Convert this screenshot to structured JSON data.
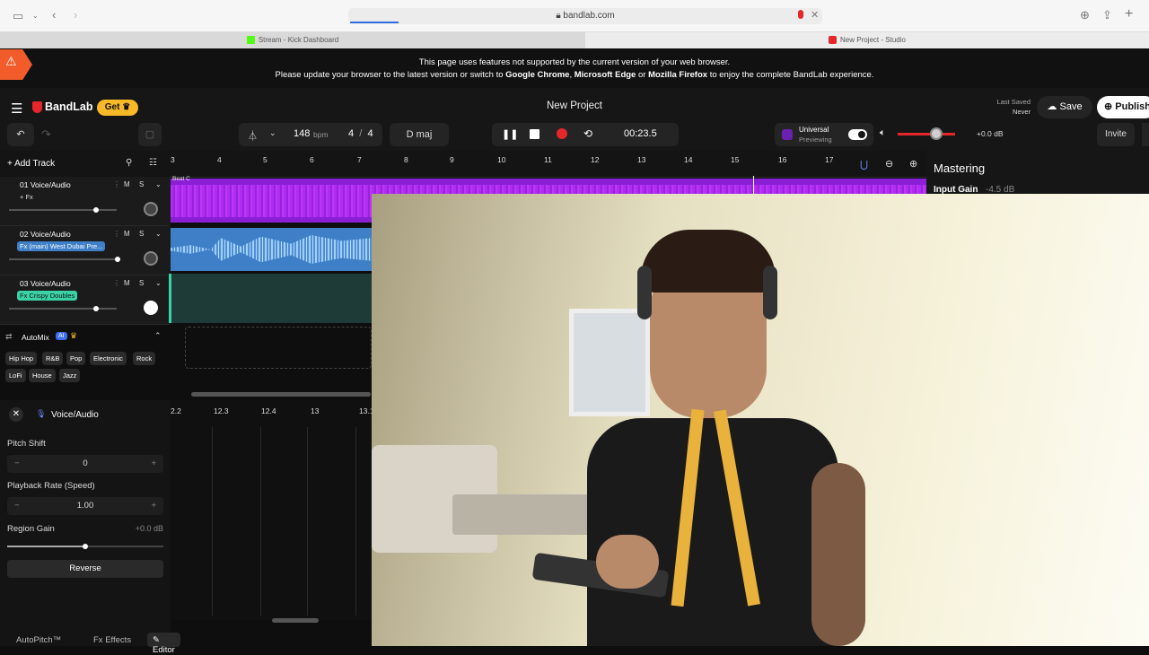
{
  "browser": {
    "url": "bandlab.com",
    "tabs": [
      {
        "label": "Stream - Kick Dashboard"
      },
      {
        "label": "New Project - Studio"
      }
    ]
  },
  "banner": {
    "line1": "This page uses features not supported by the current version of your web browser.",
    "line2_pre": "Please update your browser to the latest version or switch to ",
    "chrome": "Google Chrome",
    "sep1": ", ",
    "edge": "Microsoft Edge",
    "sep2": " or ",
    "firefox": "Mozilla Firefox",
    "line2_post": " to enjoy the complete BandLab experience."
  },
  "app": {
    "brand": "BandLab",
    "get_label": "Get",
    "project_title": "New Project",
    "last_saved_label": "Last Saved",
    "last_saved_value": "Never",
    "save_label": "Save",
    "publish_label": "Publish",
    "invite_label": "Invite"
  },
  "transport": {
    "bpm_value": "148",
    "bpm_unit": "bpm",
    "time_sig_num": "4",
    "time_sig_sep": "/",
    "time_sig_den": "4",
    "key": "D maj",
    "time": "00:23.5",
    "master_preset": "Universal",
    "master_status": "Previewing",
    "volume_db": "+0.0 dB"
  },
  "tracks_toolbar": {
    "add_track_label": "Add Track"
  },
  "ruler": [
    "3",
    "4",
    "5",
    "6",
    "7",
    "8",
    "9",
    "10",
    "11",
    "12",
    "13",
    "14",
    "15",
    "16",
    "17"
  ],
  "tracks": [
    {
      "name": "01 Voice/Audio",
      "fx": "+ Fx",
      "mute": "M",
      "solo": "S",
      "vol": 0.8
    },
    {
      "name": "02 Voice/Audio",
      "fx": "Fx (main) West Dubai Pre...",
      "mute": "M",
      "solo": "S",
      "vol": 1.0
    },
    {
      "name": "03 Voice/Audio",
      "fx": "Fx Crispy Doubles",
      "mute": "M",
      "solo": "S",
      "vol": 0.8
    }
  ],
  "region_label": "Beat C",
  "automix": {
    "label": "AutoMix",
    "ai_badge": "AI",
    "genres": [
      "Hip Hop",
      "R&B",
      "Pop",
      "Electronic",
      "Rock",
      "LoFi",
      "House",
      "Jazz"
    ]
  },
  "editor": {
    "title": "Voice/Audio",
    "pitch_shift_label": "Pitch Shift",
    "pitch_shift_value": "0",
    "playback_rate_label": "Playback Rate (Speed)",
    "playback_rate_value": "1.00",
    "region_gain_label": "Region Gain",
    "region_gain_value": "+0.0 dB",
    "reverse_label": "Reverse",
    "ruler": [
      "2.2",
      "12.3",
      "12.4",
      "13",
      "13.1"
    ],
    "tabs": [
      "AutoPitch™",
      "Effects",
      "Editor"
    ]
  },
  "mastering": {
    "title": "Mastering",
    "input_gain_label": "Input Gain",
    "input_gain_value": "-4.5 dB"
  },
  "colors": {
    "accent_red": "#e5262b",
    "track1": "#8a1fd6",
    "track2": "#3e7fc7",
    "track3": "#3bd3a6",
    "get_badge": "#f7b928"
  }
}
